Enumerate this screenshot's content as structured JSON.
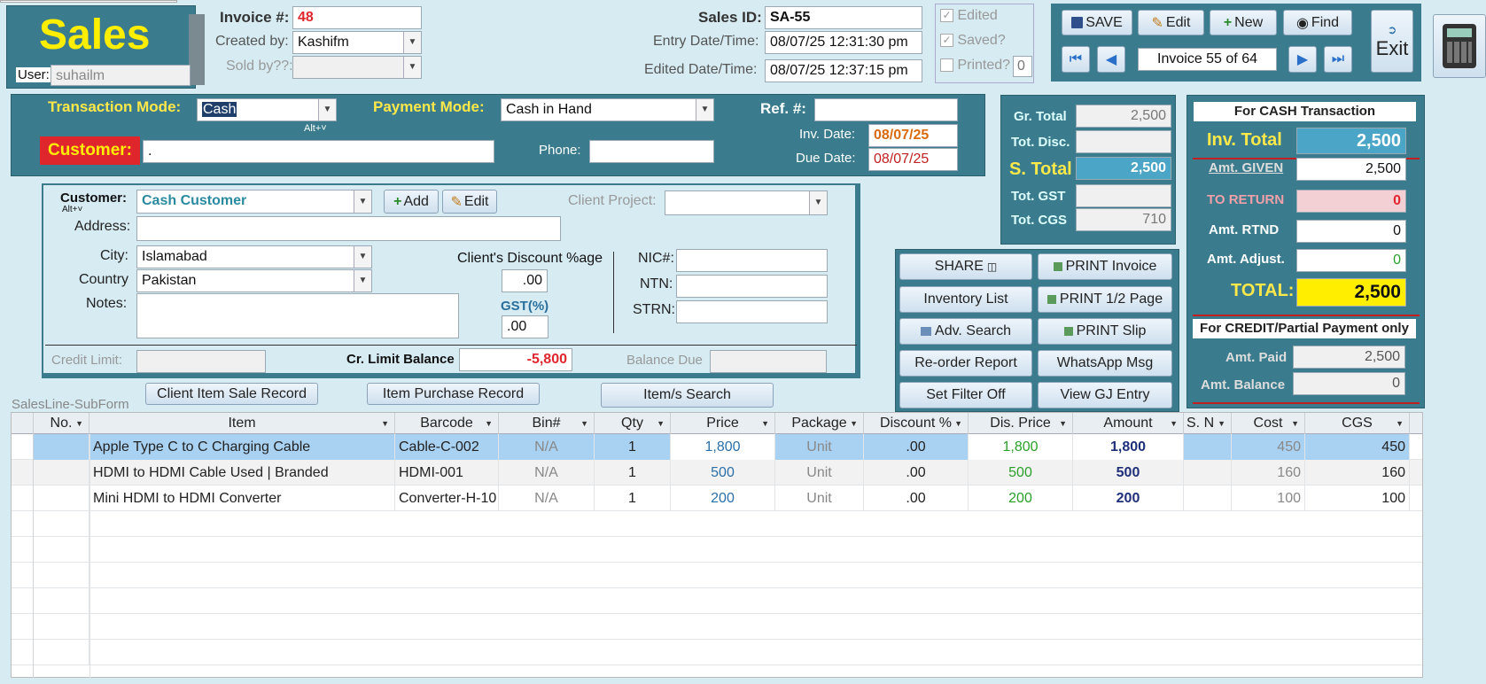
{
  "header": {
    "title": "Sales",
    "user_label": "User:",
    "user_value": "suhailm",
    "invoice_label": "Invoice #:",
    "invoice_value": "48",
    "created_by_label": "Created by:",
    "created_by_value": "Kashifm",
    "sold_by_label": "Sold by??:",
    "sales_id_label": "Sales ID:",
    "sales_id_value": "SA-55",
    "entry_label": "Entry Date/Time:",
    "entry_value": "08/07/25 12:31:30 pm",
    "edited_label": "Edited Date/Time:",
    "edited_value": "08/07/25 12:37:15 pm",
    "chk_edited": "Edited",
    "chk_saved": "Saved?",
    "chk_printed": "Printed?",
    "printed_count": "0"
  },
  "toolbar": {
    "save": "SAVE",
    "edit": "Edit",
    "new": "New",
    "find": "Find",
    "exit": "Exit",
    "record_nav": "Invoice 55 of 64"
  },
  "transaction": {
    "mode_label": "Transaction Mode:",
    "mode_value": "Cash",
    "mode_hint": "Alt+˅",
    "payment_label": "Payment Mode:",
    "payment_value": "Cash in Hand",
    "ref_label": "Ref. #:",
    "customer_label": "Customer:",
    "customer_value": ".",
    "phone_label": "Phone:",
    "inv_date_label": "Inv. Date:",
    "inv_date_value": "08/07/25",
    "due_date_label": "Due Date:",
    "due_date_value": "08/07/25"
  },
  "customer": {
    "label": "Customer:",
    "hint": "Alt+˅",
    "value": "Cash Customer",
    "add": "Add",
    "edit": "Edit",
    "project_label": "Client Project:",
    "address_label": "Address:",
    "city_label": "City:",
    "city_value": "Islamabad",
    "country_label": "Country",
    "country_value": "Pakistan",
    "notes_label": "Notes:",
    "discount_label": "Client's  Discount %age",
    "discount_value": ".00",
    "gst_label": "GST(%)",
    "gst_value": ".00",
    "nic_label": "NIC#:",
    "ntn_label": "NTN:",
    "strn_label": "STRN:",
    "credit_limit_label": "Credit Limit:",
    "cr_balance_label": "Cr. Limit Balance",
    "cr_balance_value": "-5,800",
    "balance_due_label": "Balance Due"
  },
  "totals": {
    "gr_total_label": "Gr. Total",
    "gr_total_value": "2,500",
    "disc_label": "Tot. Disc.",
    "s_total_label": "S. Total",
    "s_total_value": "2,500",
    "gst_label": "Tot. GST",
    "cgs_label": "Tot. CGS",
    "cgs_value": "710"
  },
  "cash": {
    "title": "For CASH Transaction",
    "inv_total_label": "Inv. Total",
    "inv_total_value": "2,500",
    "given_label": "Amt. GIVEN",
    "given_value": "2,500",
    "return_label": "TO RETURN",
    "return_value": "0",
    "rtnd_label": "Amt. RTND",
    "rtnd_value": "0",
    "adjust_label": "Amt. Adjust.",
    "adjust_value": "0",
    "total_label": "TOTAL:",
    "total_value": "2,500",
    "credit_title": "For CREDIT/Partial Payment only",
    "paid_label": "Amt. Paid",
    "paid_value": "2,500",
    "balance_label": "Amt.  Balance",
    "balance_value": "0"
  },
  "actions": {
    "share": "SHARE",
    "print_invoice": "PRINT Invoice",
    "inventory": "Inventory List",
    "print_half": "PRINT 1/2 Page",
    "adv_search": "Adv. Search",
    "print_slip": "PRINT Slip",
    "reorder": "Re-order Report",
    "whatsapp": "WhatsApp Msg",
    "filter_off": "Set Filter Off",
    "gj_entry": "View GJ Entry"
  },
  "lower": {
    "client_sale": "Client Item Sale Record",
    "item_purchase": "Item Purchase Record",
    "items_search": "Item/s Search",
    "subform_label": "SalesLine-SubForm"
  },
  "grid": {
    "columns": [
      "No.",
      "Item",
      "Barcode",
      "Bin#",
      "Qty",
      "Price",
      "Package",
      "Discount %",
      "Dis. Price",
      "Amount",
      "S. N",
      "Cost",
      "CGS"
    ],
    "rows": [
      {
        "no": "",
        "item": "Apple Type C to C Charging Cable",
        "barcode": "Cable-C-002",
        "bin": "N/A",
        "qty": "1",
        "price": "1,800",
        "package": "Unit",
        "disc": ".00",
        "dis_price": "1,800",
        "amount": "1,800",
        "sn": "",
        "cost": "450",
        "cgs": "450"
      },
      {
        "no": "",
        "item": "HDMI to HDMI Cable Used | Branded",
        "barcode": "HDMI-001",
        "bin": "N/A",
        "qty": "1",
        "price": "500",
        "package": "Unit",
        "disc": ".00",
        "dis_price": "500",
        "amount": "500",
        "sn": "",
        "cost": "160",
        "cgs": "160"
      },
      {
        "no": "",
        "item": "Mini HDMI to HDMI Converter",
        "barcode": "Converter-H-10",
        "bin": "N/A",
        "qty": "1",
        "price": "200",
        "package": "Unit",
        "disc": ".00",
        "dis_price": "200",
        "amount": "200",
        "sn": "",
        "cost": "100",
        "cgs": "100"
      }
    ]
  },
  "colors": {
    "teal": "#3a7c8d",
    "title_yellow": "#ffee00",
    "customer_red": "#e0262d"
  }
}
